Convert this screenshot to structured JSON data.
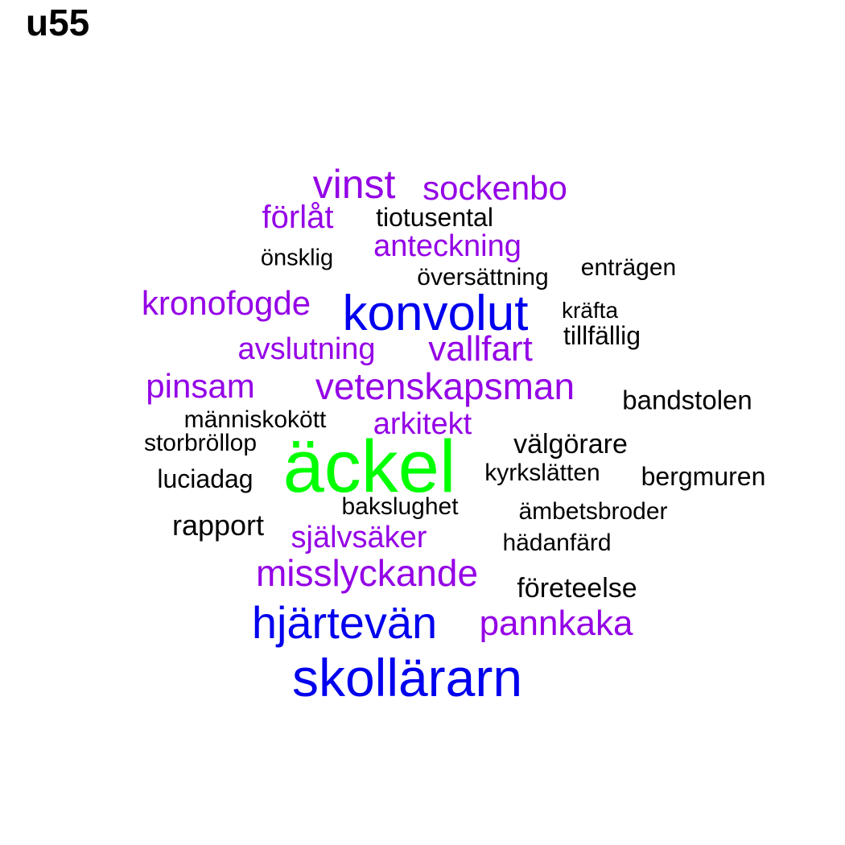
{
  "title": "u55",
  "colors": {
    "green": "#00ff00",
    "blue": "#0000ee",
    "purple": "#9400e6",
    "black": "#000000"
  },
  "words": [
    {
      "text": "äckel",
      "color": "green"
    },
    {
      "text": "skollärarn",
      "color": "blue"
    },
    {
      "text": "konvolut",
      "color": "blue"
    },
    {
      "text": "hjärtevän",
      "color": "blue"
    },
    {
      "text": "vinst",
      "color": "purple"
    },
    {
      "text": "sockenbo",
      "color": "purple"
    },
    {
      "text": "förlåt",
      "color": "purple"
    },
    {
      "text": "anteckning",
      "color": "purple"
    },
    {
      "text": "kronofogde",
      "color": "purple"
    },
    {
      "text": "avslutning",
      "color": "purple"
    },
    {
      "text": "vallfart",
      "color": "purple"
    },
    {
      "text": "pinsam",
      "color": "purple"
    },
    {
      "text": "vetenskapsman",
      "color": "purple"
    },
    {
      "text": "arkitekt",
      "color": "purple"
    },
    {
      "text": "självsäker",
      "color": "purple"
    },
    {
      "text": "misslyckande",
      "color": "purple"
    },
    {
      "text": "pannkaka",
      "color": "purple"
    },
    {
      "text": "tiotusental",
      "color": "black"
    },
    {
      "text": "önsklig",
      "color": "black"
    },
    {
      "text": "översättning",
      "color": "black"
    },
    {
      "text": "enträgen",
      "color": "black"
    },
    {
      "text": "kräfta",
      "color": "black"
    },
    {
      "text": "tillfällig",
      "color": "black"
    },
    {
      "text": "bandstolen",
      "color": "black"
    },
    {
      "text": "människokött",
      "color": "black"
    },
    {
      "text": "storbröllop",
      "color": "black"
    },
    {
      "text": "välgörare",
      "color": "black"
    },
    {
      "text": "luciadag",
      "color": "black"
    },
    {
      "text": "kyrkslätten",
      "color": "black"
    },
    {
      "text": "bergmuren",
      "color": "black"
    },
    {
      "text": "bakslughet",
      "color": "black"
    },
    {
      "text": "ämbetsbroder",
      "color": "black"
    },
    {
      "text": "rapport",
      "color": "black"
    },
    {
      "text": "hädanfärd",
      "color": "black"
    },
    {
      "text": "företeelse",
      "color": "black"
    }
  ]
}
